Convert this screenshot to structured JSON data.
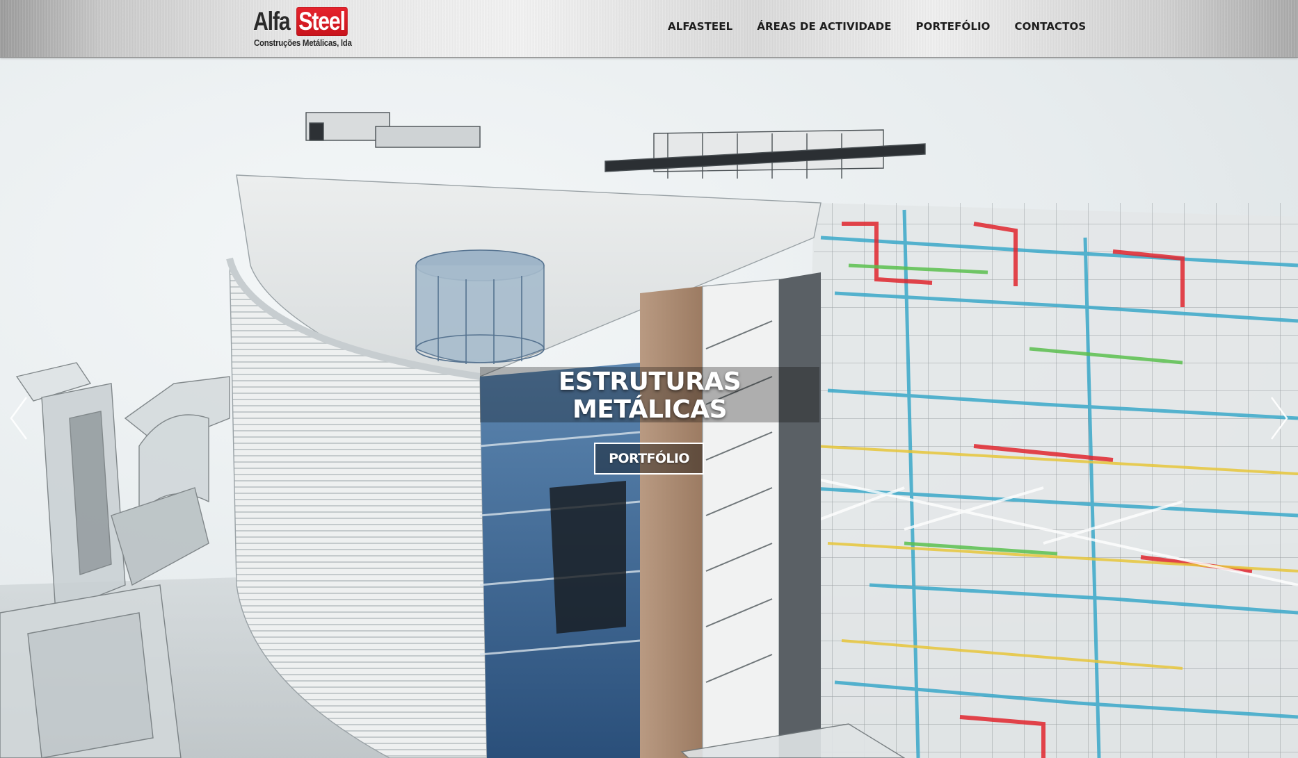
{
  "header": {
    "logo": {
      "part1": "Alfa",
      "part2": "Steel",
      "tagline": "Construções Metálicas, lda"
    },
    "nav": [
      {
        "label": "ALFASTEEL"
      },
      {
        "label": "ÁREAS DE ACTIVIDADE"
      },
      {
        "label": "PORTEFÓLIO"
      },
      {
        "label": "CONTACTOS"
      }
    ]
  },
  "hero": {
    "title": "ESTRUTURAS\nMETÁLICAS",
    "button_label": "PORTFÓLIO",
    "prev_icon": "chevron-left-icon",
    "next_icon": "chevron-right-icon"
  },
  "colors": {
    "brand_red": "#d21a22",
    "nav_text": "#1d1d1d",
    "caption_text": "#ffffff"
  }
}
